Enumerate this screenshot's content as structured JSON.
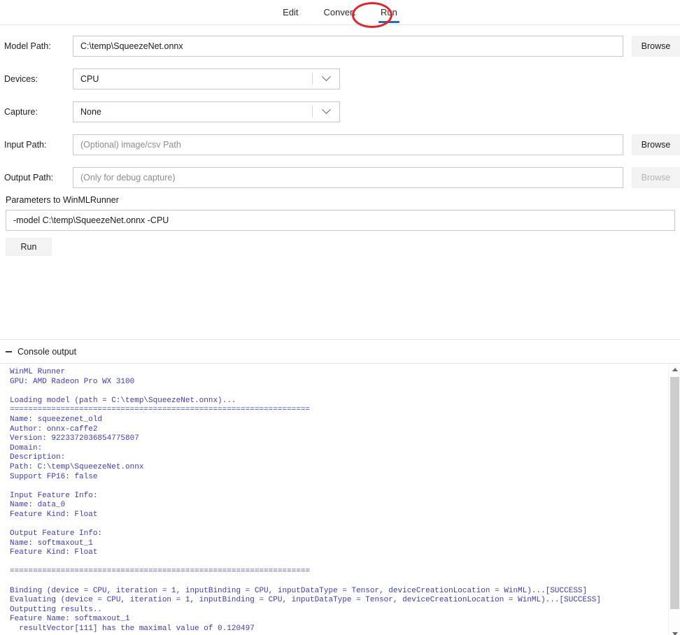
{
  "tabs": [
    {
      "label": "Edit",
      "active": false
    },
    {
      "label": "Convert",
      "active": false
    },
    {
      "label": "Run",
      "active": true
    }
  ],
  "annotation": {
    "shape": "ellipse",
    "color": "#e8202a",
    "target": "Run"
  },
  "accent_color": "#1f6fc4",
  "form": {
    "rows": [
      {
        "label": "Model Path:",
        "kind": "text",
        "value": "C:\\temp\\SqueezeNet.onnx",
        "placeholder": "",
        "button": "Browse",
        "button_disabled": false
      },
      {
        "label": "Devices:",
        "kind": "combo",
        "value": "CPU",
        "placeholder": "",
        "button": "",
        "button_disabled": false
      },
      {
        "label": "Capture:",
        "kind": "combo",
        "value": "None",
        "placeholder": "",
        "button": "",
        "button_disabled": false
      },
      {
        "label": "Input Path:",
        "kind": "text",
        "value": "",
        "placeholder": "(Optional) image/csv Path",
        "button": "Browse",
        "button_disabled": false
      },
      {
        "label": "Output Path:",
        "kind": "text",
        "value": "",
        "placeholder": "(Only for debug capture)",
        "button": "Browse",
        "button_disabled": true
      }
    ]
  },
  "params": {
    "label": "Parameters to WinMLRunner",
    "value": "-model C:\\temp\\SqueezeNet.onnx -CPU",
    "run_label": "Run"
  },
  "console": {
    "title": "Console output",
    "collapse_icon": "minus-icon",
    "text_color": "#3b3bbf",
    "output": "WinML Runner\nGPU: AMD Radeon Pro WX 3100\n\nLoading model (path = C:\\temp\\SqueezeNet.onnx)...\n=================================================================\nName: squeezenet_old\nAuthor: onnx-caffe2\nVersion: 9223372036854775807\nDomain:\nDescription:\nPath: C:\\temp\\SqueezeNet.onnx\nSupport FP16: false\n\nInput Feature Info:\nName: data_0\nFeature Kind: Float\n\nOutput Feature Info:\nName: softmaxout_1\nFeature Kind: Float\n\n=================================================================\n\nBinding (device = CPU, iteration = 1, inputBinding = CPU, inputDataType = Tensor, deviceCreationLocation = WinML)...[SUCCESS]\nEvaluating (device = CPU, iteration = 1, inputBinding = CPU, inputDataType = Tensor, deviceCreationLocation = WinML)...[SUCCESS]\nOutputting results..\nFeature Name: softmaxout_1\n  resultVector[111] has the maximal value of 0.120497"
  },
  "scrollbar": {
    "up_icon": "triangle-up-icon",
    "down_icon": "triangle-down-icon"
  }
}
